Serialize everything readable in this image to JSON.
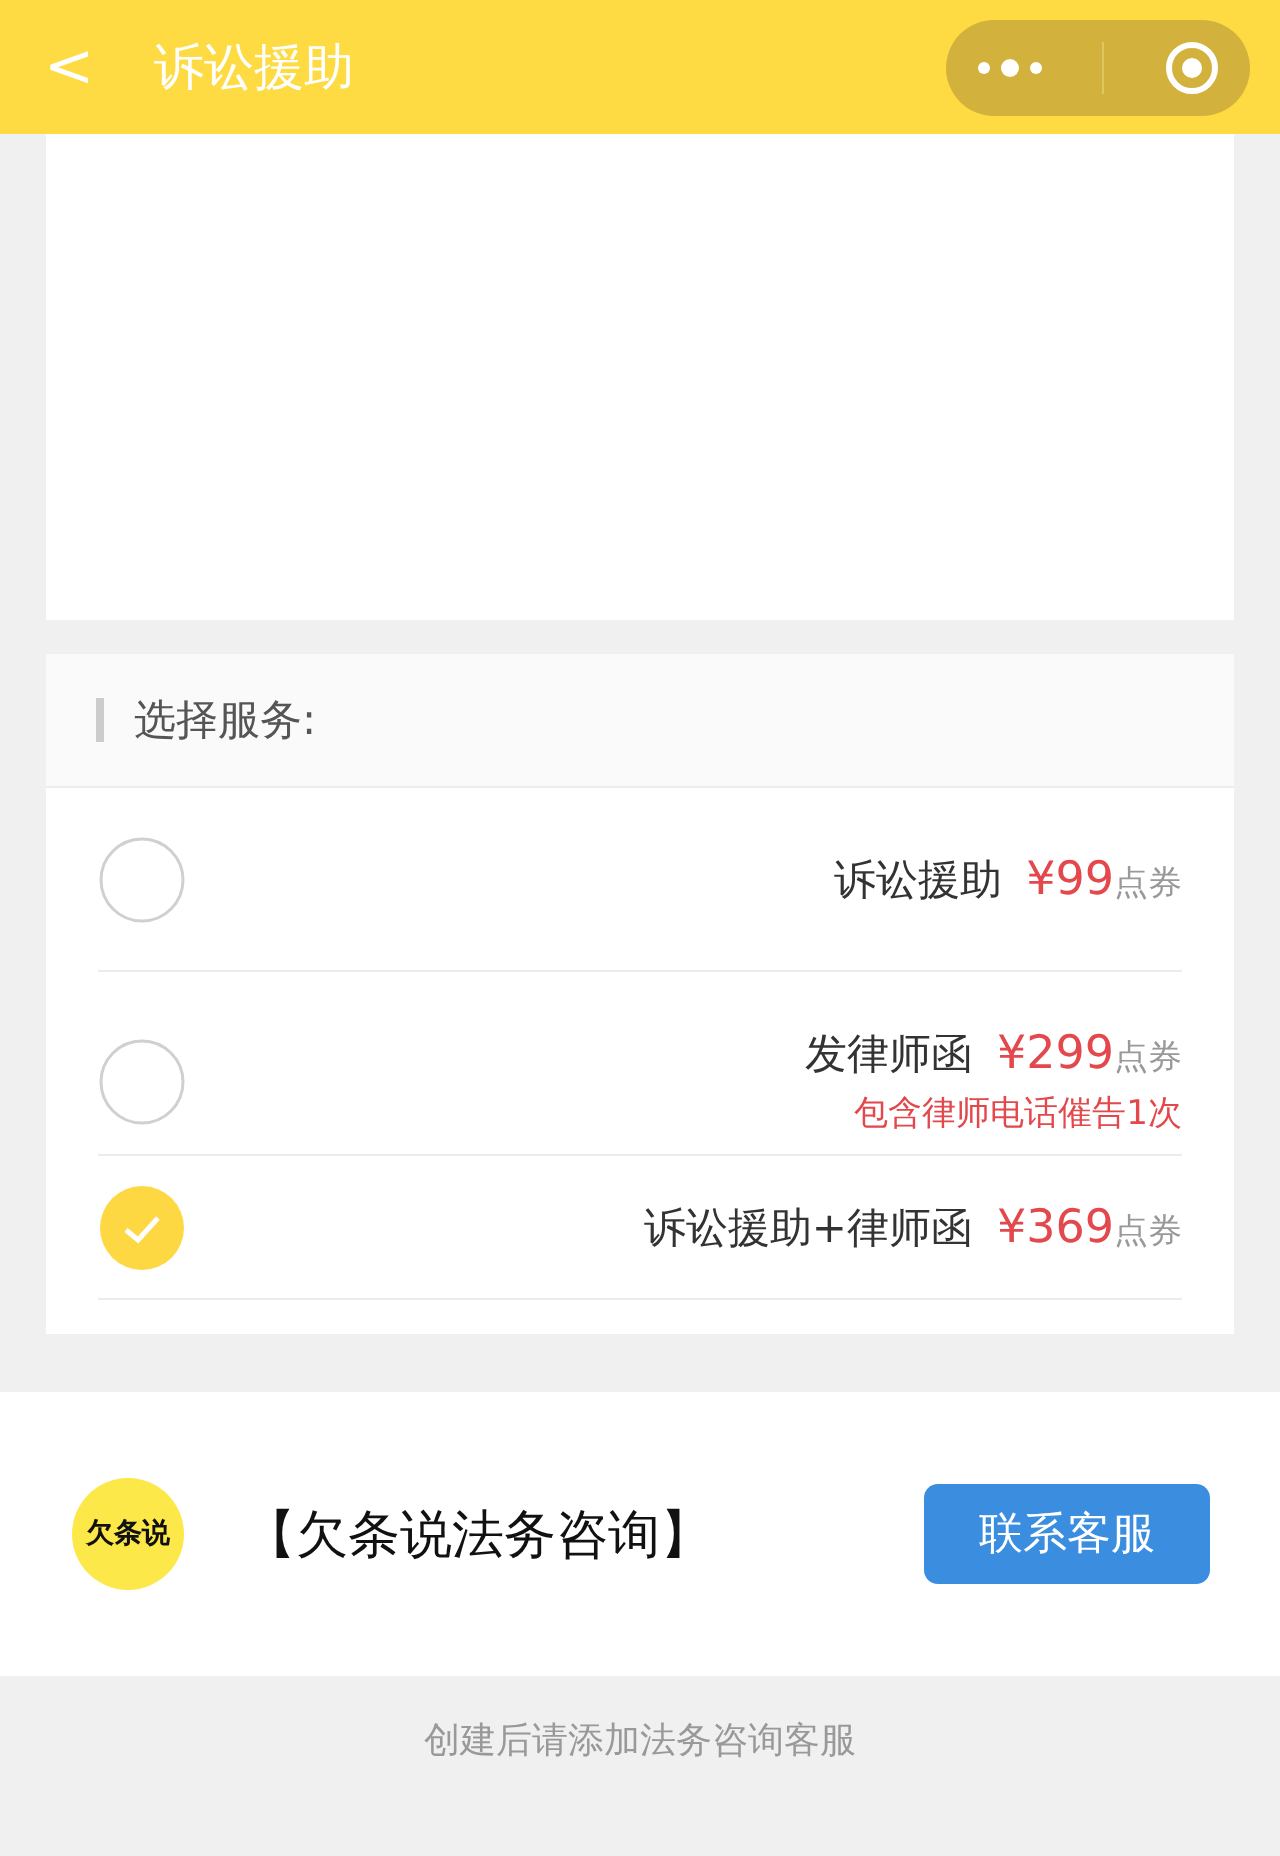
{
  "nav_bar": {
    "back": "<",
    "title": "诉讼援助"
  },
  "section_title": "选择服务:",
  "services": [
    {
      "name": "诉讼援助",
      "price": "¥99",
      "unit": "点券",
      "selected": false
    },
    {
      "name": "发律师函",
      "price": "¥299",
      "unit": "点券",
      "note": "包含律师电话催告1次",
      "selected": false
    },
    {
      "name": "诉讼援助+律师函",
      "price": "¥369",
      "unit": "点券",
      "selected": true
    }
  ],
  "contact": {
    "logo_text": "欠条说",
    "name": "【欠条说法务咨询】",
    "button": "联系客服"
  },
  "footer_hint": "创建后请添加法务咨询客服"
}
